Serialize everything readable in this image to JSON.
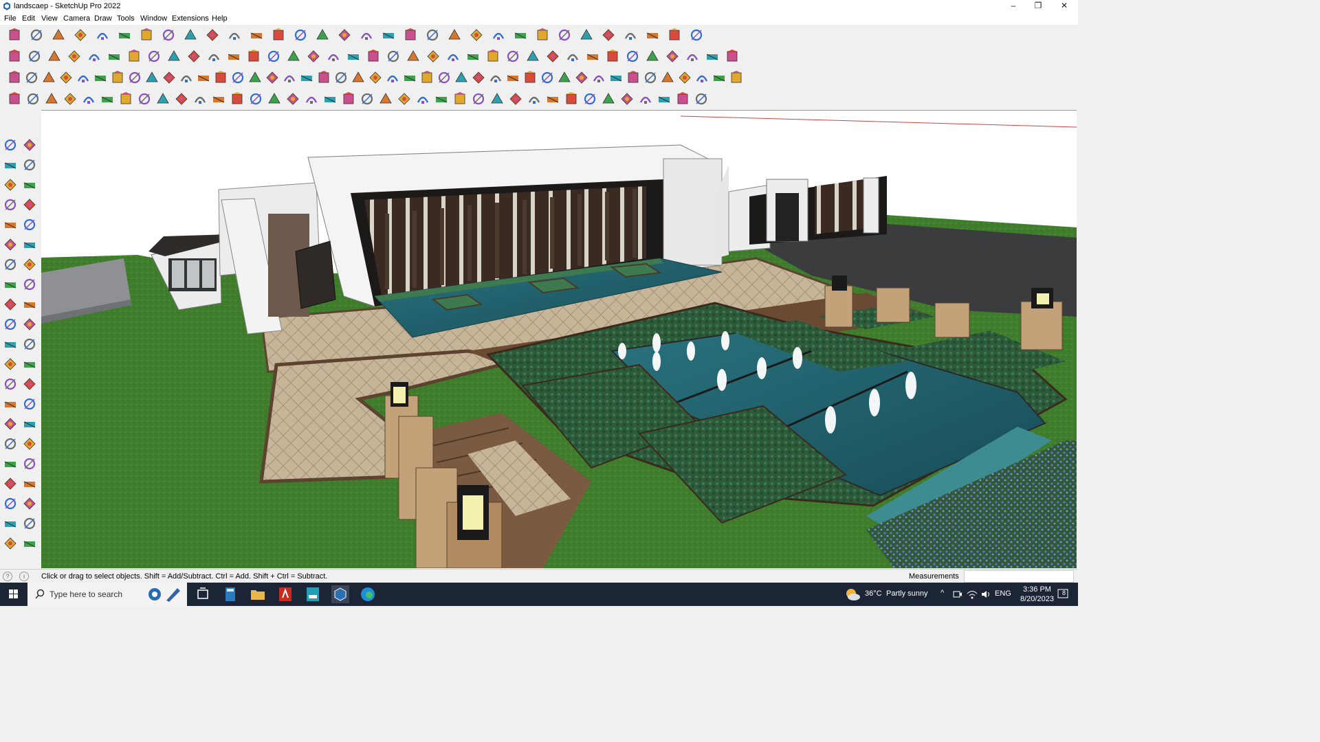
{
  "window": {
    "title": "landscaep - SketchUp Pro 2022",
    "minimize": "–",
    "restore": "❐",
    "close": "✕"
  },
  "menu": [
    "File",
    "Edit",
    "View",
    "Camera",
    "Draw",
    "Tools",
    "Window",
    "Extensions",
    "Help"
  ],
  "status": {
    "hint": "Click or drag to select objects. Shift = Add/Subtract. Ctrl = Add. Shift + Ctrl = Subtract.",
    "measurements_label": "Measurements",
    "measurements_value": ""
  },
  "taskbar": {
    "search_placeholder": "Type here to search",
    "weather_temp": "36°C",
    "weather_desc": "Partly sunny",
    "language": "ENG",
    "time": "3:36 PM",
    "date": "8/20/2023",
    "notification_count": "8"
  },
  "toolbar_icons": {
    "row1": [
      "zoom-icon",
      "select-icon",
      "eraser-icon",
      "pencil-icon",
      "lasso-icon",
      "rectangle-icon",
      "push-pull-icon",
      "follow-me-icon",
      "move-icon",
      "rotate-icon",
      "scale-icon",
      "tape-icon",
      "text-icon",
      "paint-icon",
      "orbit-icon",
      "pan-icon",
      "zoom-window-icon",
      "zoom-extents-icon",
      "section-icon",
      "layers-icon",
      "styles-icon",
      "fog-icon",
      "shadows-icon",
      "component-icon",
      "material-icon",
      "sandbox-icon",
      "extension-icon",
      "extension-icon",
      "extension-icon",
      "undo-icon",
      "redo-icon",
      "extension-icon"
    ],
    "row2": [
      "iso-view-icon",
      "top-view-icon",
      "front-view-icon",
      "extension-icon",
      "extension-icon",
      "extension-icon",
      "extension-icon",
      "extension-icon",
      "extension-icon",
      "extension-icon",
      "extension-icon",
      "extension-icon",
      "extension-icon",
      "extension-icon",
      "house-icon",
      "house-icon",
      "house-icon",
      "house-icon",
      "font-icon",
      "extension-icon",
      "extension-icon",
      "shape-icon",
      "shape-icon",
      "shape-icon",
      "shape-icon",
      "shape-icon",
      "shape-icon",
      "shape-icon",
      "shape-icon",
      "shape-icon",
      "shape-icon",
      "extension-icon",
      "extension-icon",
      "extension-icon",
      "extension-icon",
      "extension-icon",
      "extension-icon"
    ],
    "row3": [
      "extension-icon",
      "extension-icon",
      "extension-icon",
      "extension-icon",
      "extension-icon",
      "extension-icon",
      "extension-icon",
      "extension-icon",
      "extension-icon",
      "extension-icon",
      "extension-icon",
      "extension-icon",
      "extension-icon",
      "extension-icon",
      "extension-icon",
      "extension-icon",
      "extension-icon",
      "extension-icon",
      "extension-icon",
      "extension-icon",
      "extension-icon",
      "extension-icon",
      "extension-icon",
      "extension-icon",
      "extension-icon",
      "extension-icon",
      "extension-icon",
      "extension-icon",
      "extension-icon",
      "extension-icon",
      "extension-icon",
      "extension-icon",
      "extension-icon",
      "extension-icon",
      "extension-icon",
      "extension-icon",
      "extension-icon",
      "extension-icon",
      "extension-icon",
      "extension-icon",
      "extension-icon",
      "extension-icon",
      "extension-icon"
    ],
    "row4": [
      "extension-icon",
      "extension-icon",
      "extension-icon",
      "extension-icon",
      "extension-icon",
      "extension-icon",
      "extension-icon",
      "extension-icon",
      "extension-icon",
      "extension-icon",
      "extension-icon",
      "extension-icon",
      "extension-icon",
      "extension-icon",
      "extension-icon",
      "extension-icon",
      "extension-icon",
      "extension-icon",
      "extension-icon",
      "extension-icon",
      "extension-icon",
      "extension-icon",
      "extension-icon",
      "extension-icon",
      "extension-icon",
      "extension-icon",
      "extension-icon",
      "extension-icon",
      "extension-icon",
      "extension-icon",
      "extension-icon",
      "extension-icon",
      "extension-icon",
      "extension-icon",
      "extension-icon",
      "extension-icon",
      "extension-icon",
      "extension-icon"
    ]
  },
  "left_tools": [
    "select-tool",
    "orbit-tool",
    "paint-bucket-tool",
    "eraser-tool",
    "component-tool",
    "tape-measure-tool",
    "line-tool",
    "freehand-tool",
    "rectangle-tool",
    "rotated-rectangle-tool",
    "circle-tool",
    "polygon-tool",
    "arc-tool",
    "pie-tool",
    "two-point-arc-tool",
    "three-point-arc-tool",
    "move-tool",
    "push-pull-tool",
    "rotate-tool",
    "follow-me-tool",
    "scale-tool",
    "offset-tool",
    "tape-tool",
    "dimension-tool",
    "protractor-tool",
    "text-tool",
    "axes-tool",
    "3d-text-tool",
    "orbit-tool",
    "pan-tool",
    "zoom-tool",
    "zoom-window-tool",
    "zoom-extents-tool",
    "previous-view-tool",
    "position-camera-tool",
    "look-around-tool",
    "walk-tool",
    "section-plane-tool",
    "warehouse-tool",
    "extension-tool",
    "layers-tool",
    "styles-tool"
  ],
  "colors": {
    "grass": "#3f7d2c",
    "water": "#1f5d66",
    "paving": "#c7b59a",
    "stone": "#e8e8e8",
    "screen": "#3a2a22",
    "hedge": "#2c5a3a",
    "taskbar": "#1c2536"
  }
}
